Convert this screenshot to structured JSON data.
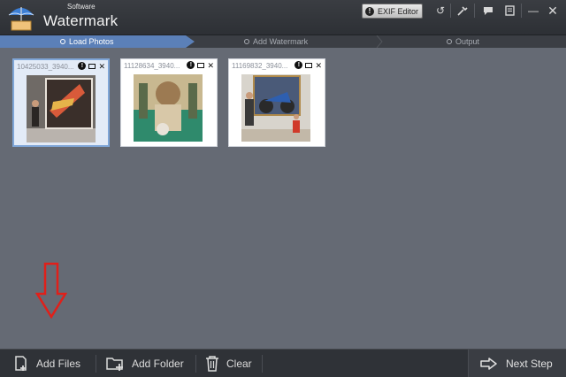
{
  "app": {
    "brand_small": "Software",
    "brand_big": "Watermark"
  },
  "titlebar": {
    "exif_label": "EXIF Editor",
    "icons": [
      "undo-icon",
      "wand-icon",
      "chat-icon",
      "document-icon",
      "minimize-icon",
      "close-icon"
    ]
  },
  "steps": [
    {
      "label": "Load Photos",
      "active": true
    },
    {
      "label": "Add Watermark",
      "active": false
    },
    {
      "label": "Output",
      "active": false
    }
  ],
  "photos": [
    {
      "title": "10425033_3940...",
      "selected": true
    },
    {
      "title": "11128634_3940...",
      "selected": false
    },
    {
      "title": "11169832_3940...",
      "selected": false
    }
  ],
  "toolbar": {
    "add_files": "Add Files",
    "add_folder": "Add Folder",
    "clear": "Clear",
    "next_step": "Next Step"
  },
  "colors": {
    "accent": "#5b80b8",
    "workspace": "#656a74",
    "annotation_arrow": "#e0201a"
  }
}
